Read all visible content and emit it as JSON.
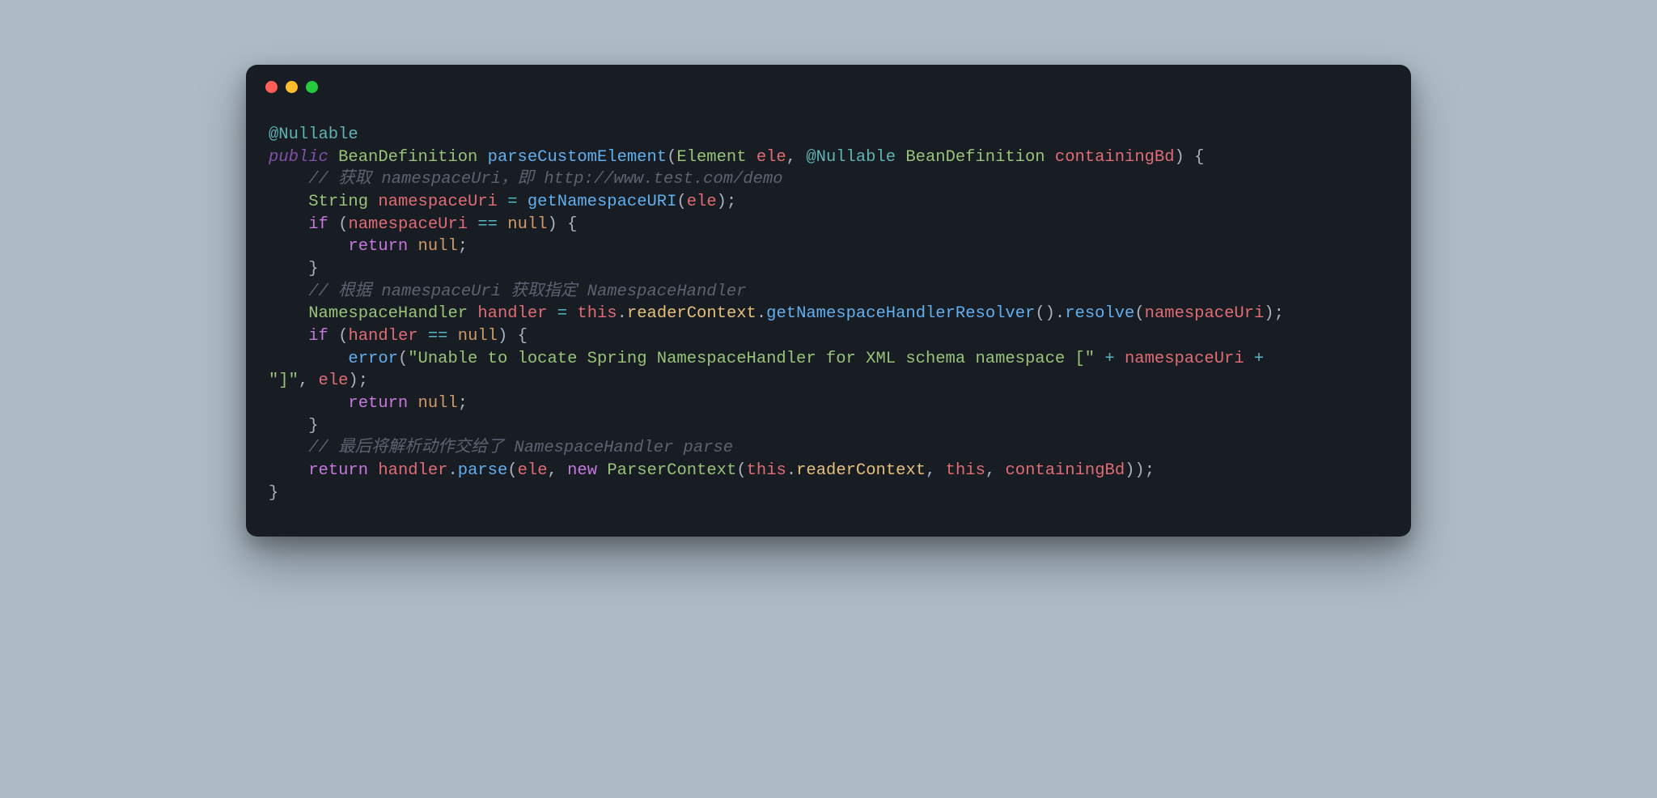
{
  "code": {
    "l1_ann": "@Nullable",
    "l2_a": "public ",
    "l2_b": "BeanDefinition ",
    "l2_c": "parseCustomElement",
    "l2_d": "(",
    "l2_e": "Element ",
    "l2_f": "ele",
    "l2_g": ", ",
    "l2_h": "@Nullable",
    "l2_i": " BeanDefinition ",
    "l2_j": "containingBd",
    "l2_k": ") {",
    "l3": "    // 获取 namespaceUri，即 http://www.test.com/demo",
    "l4_a": "    ",
    "l4_b": "String ",
    "l4_c": "namespaceUri",
    "l4_d": " = ",
    "l4_e": "getNamespaceURI",
    "l4_f": "(",
    "l4_g": "ele",
    "l4_h": ");",
    "l5_a": "    ",
    "l5_b": "if ",
    "l5_c": "(",
    "l5_d": "namespaceUri",
    "l5_e": " == ",
    "l5_f": "null",
    "l5_g": ") {",
    "l6_a": "        ",
    "l6_b": "return ",
    "l6_c": "null",
    "l6_d": ";",
    "l7": "    }",
    "l8": "    // 根据 namespaceUri 获取指定 NamespaceHandler",
    "l9_a": "    ",
    "l9_b": "NamespaceHandler ",
    "l9_c": "handler",
    "l9_d": " = ",
    "l9_e": "this",
    "l9_f": ".",
    "l9_g": "readerContext",
    "l9_h": ".",
    "l9_i": "getNamespaceHandlerResolver",
    "l9_j": "().",
    "l9_k": "resolve",
    "l9_l": "(",
    "l9_m": "namespaceUri",
    "l9_n": ");",
    "l10_a": "    ",
    "l10_b": "if ",
    "l10_c": "(",
    "l10_d": "handler",
    "l10_e": " == ",
    "l10_f": "null",
    "l10_g": ") {",
    "l11_a": "        ",
    "l11_b": "error",
    "l11_c": "(",
    "l11_d": "\"Unable to locate Spring NamespaceHandler for XML schema namespace [\"",
    "l11_e": " + ",
    "l11_f": "namespaceUri",
    "l11_g": " + ",
    "l12_a": "\"]\"",
    "l12_b": ", ",
    "l12_c": "ele",
    "l12_d": ");",
    "l13_a": "        ",
    "l13_b": "return ",
    "l13_c": "null",
    "l13_d": ";",
    "l14": "    }",
    "l15": "    // 最后将解析动作交给了 NamespaceHandler parse",
    "l16_a": "    ",
    "l16_b": "return ",
    "l16_c": "handler",
    "l16_d": ".",
    "l16_e": "parse",
    "l16_f": "(",
    "l16_g": "ele",
    "l16_h": ", ",
    "l16_i": "new ",
    "l16_j": "ParserContext",
    "l16_k": "(",
    "l16_l": "this",
    "l16_m": ".",
    "l16_n": "readerContext",
    "l16_o": ", ",
    "l16_p": "this",
    "l16_q": ", ",
    "l16_r": "containingBd",
    "l16_s": "));",
    "l17": "}"
  }
}
